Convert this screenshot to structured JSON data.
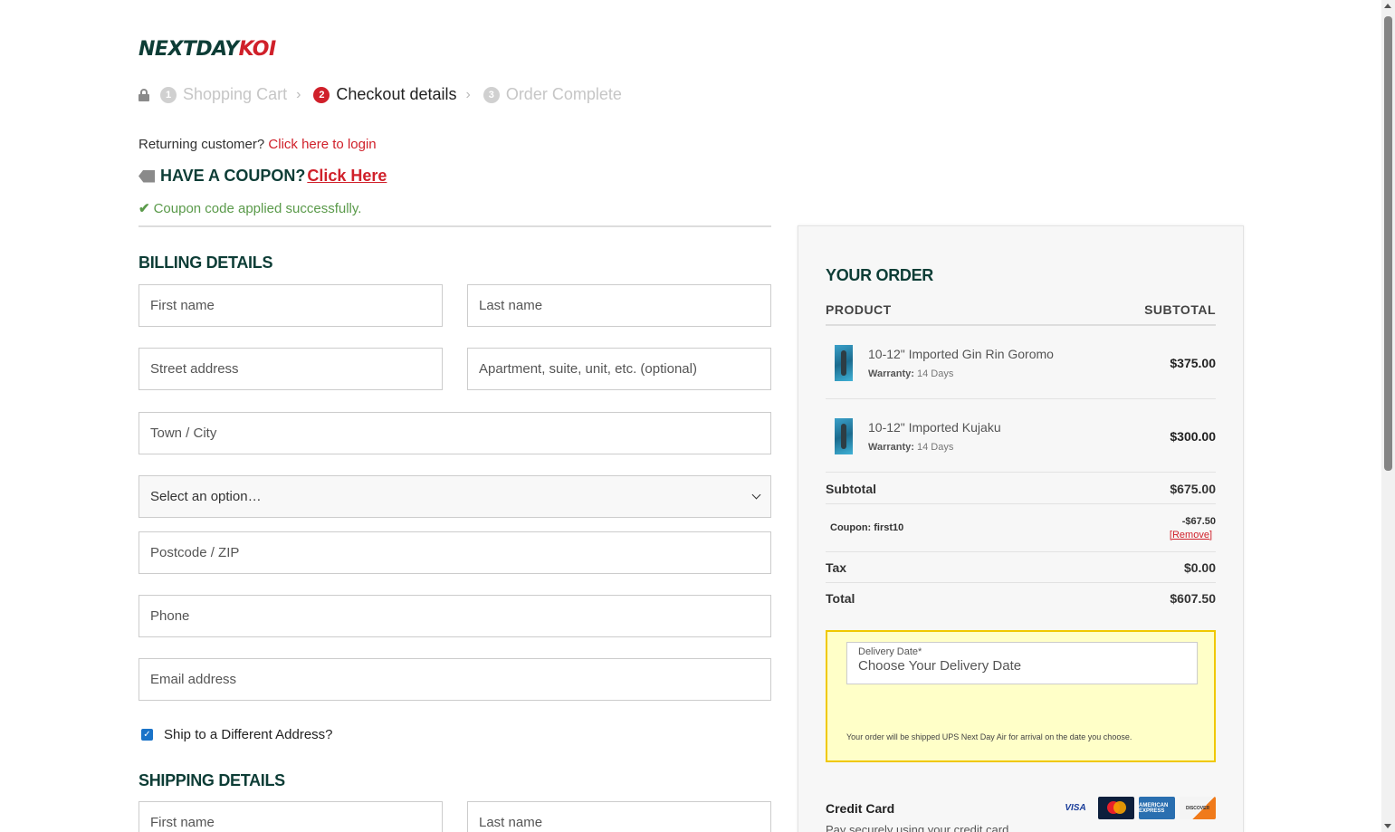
{
  "logo": {
    "part1": "NEXTDAY",
    "part2": "KOI"
  },
  "steps": [
    {
      "num": "1",
      "label": "Shopping Cart"
    },
    {
      "num": "2",
      "label": "Checkout details"
    },
    {
      "num": "3",
      "label": "Order Complete"
    }
  ],
  "returning": {
    "text": "Returning customer?",
    "link": "Click here to login"
  },
  "coupon": {
    "heading": "HAVE A COUPON?",
    "link": "Click Here",
    "success": "Coupon code applied successfully."
  },
  "billing": {
    "title": "BILLING DETAILS",
    "first_name": "First name",
    "last_name": "Last name",
    "street": "Street address",
    "apartment": "Apartment, suite, unit, etc. (optional)",
    "city": "Town / City",
    "state": "Select an option…",
    "postcode": "Postcode / ZIP",
    "phone": "Phone",
    "email": "Email address"
  },
  "ship_different": {
    "label": "Ship to a Different Address?",
    "checked": true
  },
  "shipping": {
    "title": "SHIPPING DETAILS",
    "first_name": "First name",
    "last_name": "Last name"
  },
  "order": {
    "title": "YOUR ORDER",
    "col_product": "PRODUCT",
    "col_subtotal": "SUBTOTAL",
    "items": [
      {
        "name": "10-12\" Imported Gin Rin Goromo",
        "warranty_label": "Warranty:",
        "warranty": "14 Days",
        "price": "$375.00"
      },
      {
        "name": "10-12\" Imported Kujaku",
        "warranty_label": "Warranty:",
        "warranty": "14 Days",
        "price": "$300.00"
      }
    ],
    "subtotal_label": "Subtotal",
    "subtotal": "$675.00",
    "coupon_label": "Coupon: first10",
    "coupon_amount": "-$67.50",
    "coupon_remove": "[Remove]",
    "tax_label": "Tax",
    "tax": "$0.00",
    "total_label": "Total",
    "total": "$607.50",
    "delivery_label": "Delivery Date*",
    "delivery_placeholder": "Choose Your Delivery Date",
    "delivery_note": "Your order will be shipped UPS Next Day Air for arrival on the date you choose.",
    "payment_label": "Credit Card",
    "payment_desc": "Pay securely using your credit card.",
    "cards": [
      "VISA",
      "",
      "AMERICAN EXPRESS",
      "DISCOVER"
    ]
  },
  "colors": {
    "brand_dark": "#0d3d36",
    "brand_red": "#d0202a",
    "success": "#5a9a4a",
    "delivery_bg": "#ffffc8",
    "delivery_border": "#f0c800"
  }
}
